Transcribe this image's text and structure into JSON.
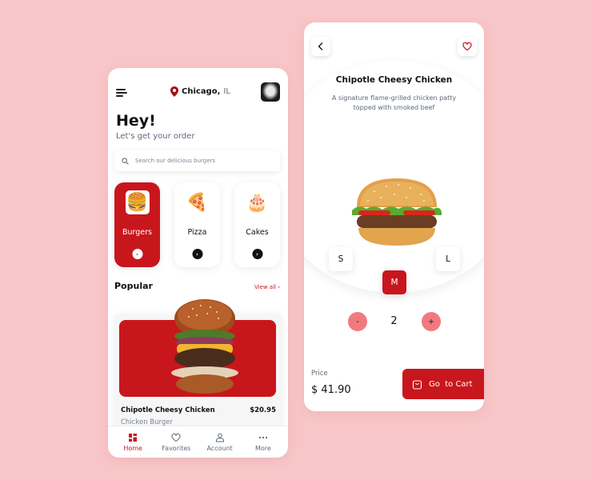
{
  "home": {
    "location": {
      "city": "Chicago,",
      "state": "IL"
    },
    "greeting": "Hey!",
    "subtitle": "Let's get your order",
    "search": {
      "placeholder": "Search our delicious burgers",
      "value": ""
    },
    "categories": [
      {
        "label": "Burgers",
        "icon": "burger-icon",
        "glyph": "🍔",
        "active": true
      },
      {
        "label": "Pizza",
        "icon": "pizza-icon",
        "glyph": "🍕",
        "active": false
      },
      {
        "label": "Cakes",
        "icon": "cake-icon",
        "glyph": "🎂",
        "active": false
      }
    ],
    "popular": {
      "title": "Popular",
      "view_all": "View all ›"
    },
    "product": {
      "name": "Chipotle Cheesy Chicken",
      "price": "$20.95",
      "type": "Chicken Burger"
    },
    "tabs": [
      {
        "label": "Home",
        "icon": "home-icon",
        "active": true
      },
      {
        "label": "Favorites",
        "icon": "heart-icon",
        "active": false
      },
      {
        "label": "Account",
        "icon": "account-icon",
        "active": false
      },
      {
        "label": "More",
        "icon": "more-icon",
        "active": false
      }
    ]
  },
  "detail": {
    "title": "Chipotle Cheesy Chicken",
    "description": "A signature flame-grilled chicken patty topped with smoked beef",
    "sizes": [
      "S",
      "M",
      "L"
    ],
    "selected_size": "M",
    "quantity": "2",
    "minus_label": "-",
    "plus_label": "+",
    "price_label": "Price",
    "price": "$ 41.90",
    "cart_button": "Go  to Cart"
  },
  "colors": {
    "accent": "#c8161d",
    "background": "#f8c6c8",
    "qty_button": "#f07a80",
    "muted_text": "#5e6a7a"
  }
}
